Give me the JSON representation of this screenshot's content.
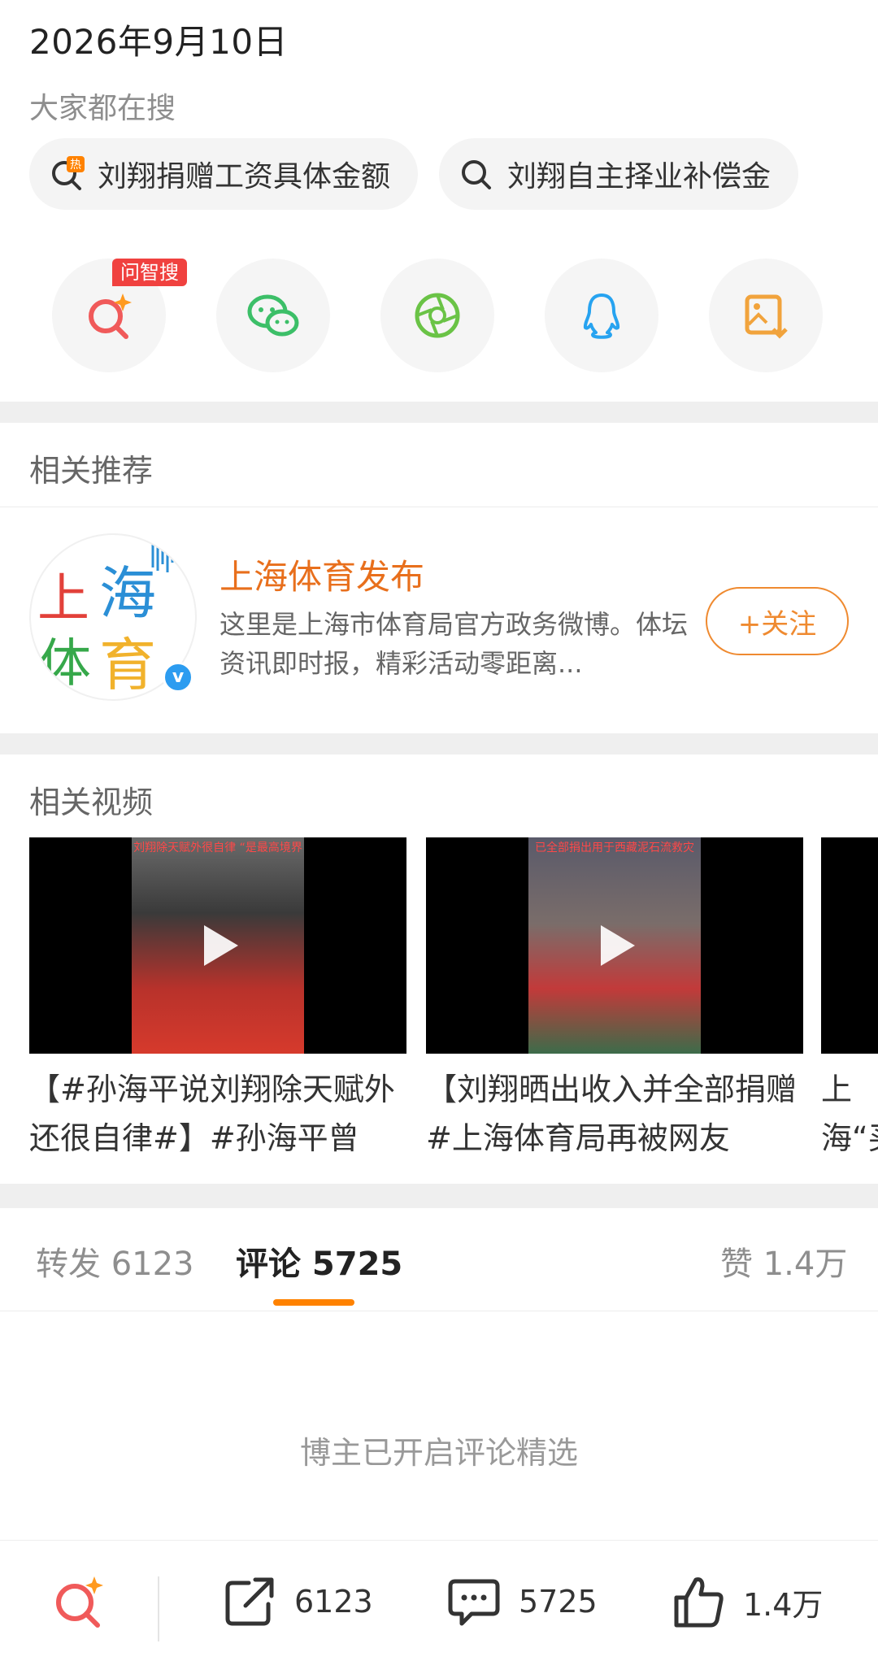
{
  "date": "2026年9月10日",
  "search_hint": "大家都在搜",
  "hot_searches": [
    {
      "label": "刘翔捐赠工资具体金额",
      "icon": "hot-search-icon"
    },
    {
      "label": "刘翔自主择业补偿金",
      "icon": "search-icon"
    }
  ],
  "share": {
    "ai_badge": "问智搜",
    "items": [
      "ai-search-icon",
      "wechat-icon",
      "moments-icon",
      "qq-icon",
      "save-image-icon"
    ]
  },
  "recommend": {
    "title": "相关推荐",
    "account_name": "上海体育发布",
    "description": "这里是上海市体育局官方政务微博。体坛资讯即时报，精彩活动零距离...",
    "verified_badge": "v",
    "follow_label": "+关注"
  },
  "videos": {
    "title": "相关视频",
    "items": [
      {
        "title": "【#孙海平说刘翔除天赋外还很自律#】#孙海平曾",
        "caption": "刘翔除天赋外很自律 “是最高境界"
      },
      {
        "title": "【刘翔晒出收入并全部捐赠 #上海体育局再被网友",
        "caption": "已全部捐出用于西藏泥石流救灾"
      },
      {
        "title": "上海“买断"
      }
    ]
  },
  "tabs": {
    "repost": "转发 6123",
    "comment": "评论 5725",
    "like": "赞 1.4万"
  },
  "empty_message": "博主已开启评论精选",
  "bottom_bar": {
    "repost_count": "6123",
    "comment_count": "5725",
    "like_count": "1.4万"
  },
  "colors": {
    "accent": "#ff8200",
    "name": "#e86f1c",
    "badge": "#f0413f"
  }
}
